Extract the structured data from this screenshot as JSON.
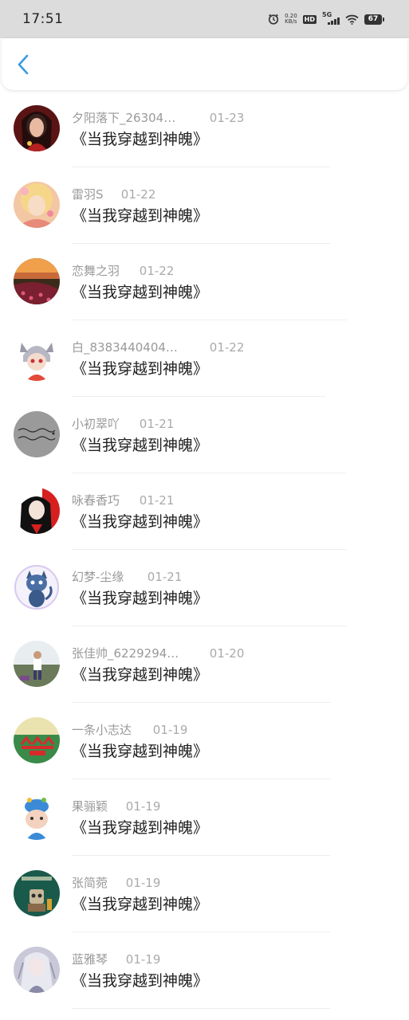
{
  "status_bar": {
    "time": "17:51",
    "net_speed_value": "0.20",
    "net_speed_unit": "KB/s",
    "hd_label": "HD",
    "network_label": "5G",
    "battery": "67"
  },
  "header": {
    "back_icon": "chevron-left-icon",
    "accent_color": "#3b9ae1"
  },
  "list": [
    {
      "nickname": "夕阳落下_26304…",
      "date": "01-23",
      "title": "《当我穿越到神魄》"
    },
    {
      "nickname": "雷羽S",
      "date": "01-22",
      "title": "《当我穿越到神魄》"
    },
    {
      "nickname": "恋舞之羽",
      "date": "01-22",
      "title": "《当我穿越到神魄》"
    },
    {
      "nickname": "白_8383440404…",
      "date": "01-22",
      "title": "《当我穿越到神魄》"
    },
    {
      "nickname": "小初翠吖",
      "date": "01-21",
      "title": "《当我穿越到神魄》"
    },
    {
      "nickname": "咏春香巧",
      "date": "01-21",
      "title": "《当我穿越到神魄》"
    },
    {
      "nickname": "幻梦-尘缘",
      "date": "01-21",
      "title": "《当我穿越到神魄》"
    },
    {
      "nickname": "张佳帅_6229294…",
      "date": "01-20",
      "title": "《当我穿越到神魄》"
    },
    {
      "nickname": "一条小志达",
      "date": "01-19",
      "title": "《当我穿越到神魄》"
    },
    {
      "nickname": "果骊颖",
      "date": "01-19",
      "title": "《当我穿越到神魄》"
    },
    {
      "nickname": "张简菀",
      "date": "01-19",
      "title": "《当我穿越到神魄》"
    },
    {
      "nickname": "蓝雅琴",
      "date": "01-19",
      "title": "《当我穿越到神魄》"
    }
  ]
}
